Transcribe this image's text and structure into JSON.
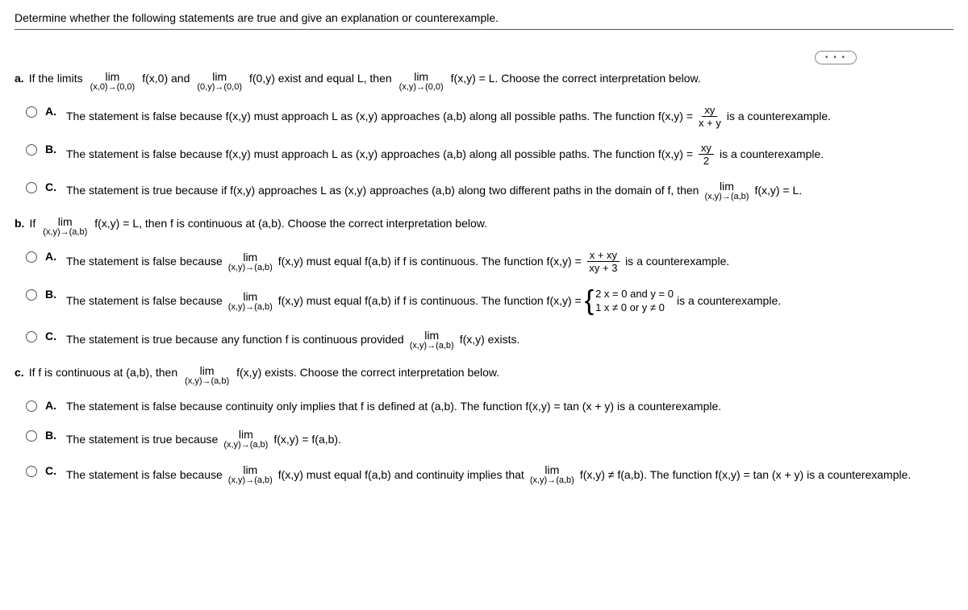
{
  "title": "Determine whether the following statements are true and give an explanation or counterexample.",
  "dots": "• • •",
  "partA": {
    "label": "a.",
    "s1": "If the limits",
    "lim1_top": "lim",
    "lim1_bot": "(x,0)→(0,0)",
    "lim1_after": "f(x,0) and",
    "lim2_top": "lim",
    "lim2_bot": "(0,y)→(0,0)",
    "lim2_after": "f(0,y) exist and equal L, then",
    "lim3_top": "lim",
    "lim3_bot": "(x,y)→(0,0)",
    "lim3_after": "f(x,y) = L. Choose the correct interpretation below.",
    "A": {
      "label": "A.",
      "s1": "The statement is false because f(x,y) must approach L as (x,y) approaches (a,b) along all possible paths. The function f(x,y) =",
      "frac_num": "xy",
      "frac_den": "x + y",
      "s2": "is a counterexample."
    },
    "B": {
      "label": "B.",
      "s1": "The statement is false because f(x,y) must approach L as (x,y) approaches (a,b) along all possible paths. The function f(x,y) =",
      "frac_num": "xy",
      "frac_den": "2",
      "s2": "is a counterexample."
    },
    "C": {
      "label": "C.",
      "s1": "The statement is true because if f(x,y) approaches L as (x,y) approaches (a,b) along two different paths in the domain of f, then",
      "lim_top": "lim",
      "lim_bot": "(x,y)→(a,b)",
      "lim_after": "f(x,y) = L."
    }
  },
  "partB": {
    "label": "b.",
    "s1": "If",
    "lim_top": "lim",
    "lim_bot": "(x,y)→(a,b)",
    "lim_after": "f(x,y) = L, then f is continuous at (a,b). Choose the correct interpretation below.",
    "A": {
      "label": "A.",
      "s1": "The statement is false because",
      "lim_top": "lim",
      "lim_bot": "(x,y)→(a,b)",
      "s2": "f(x,y) must equal f(a,b) if f is continuous. The function f(x,y) =",
      "frac_num": "x + xy",
      "frac_den": "xy + 3",
      "s3": "is a counterexample."
    },
    "B": {
      "label": "B.",
      "s1": "The statement is false because",
      "lim_top": "lim",
      "lim_bot": "(x,y)→(a,b)",
      "s2": "f(x,y) must equal f(a,b) if f is continuous. The function f(x,y) =",
      "case1": "2   x = 0 and y = 0",
      "case2": "1   x ≠ 0 or y ≠ 0",
      "s3": "is a counterexample."
    },
    "C": {
      "label": "C.",
      "s1": "The statement is true because any function f is continuous provided",
      "lim_top": "lim",
      "lim_bot": "(x,y)→(a,b)",
      "lim_after": "f(x,y) exists."
    }
  },
  "partC": {
    "label": "c.",
    "s1": "If f is continuous at (a,b), then",
    "lim_top": "lim",
    "lim_bot": "(x,y)→(a,b)",
    "lim_after": "f(x,y) exists. Choose the correct interpretation below.",
    "A": {
      "label": "A.",
      "s1": "The statement is false because continuity only implies that f is defined at (a,b). The function f(x,y) = tan (x + y) is a counterexample."
    },
    "B": {
      "label": "B.",
      "s1": "The statement is true because",
      "lim_top": "lim",
      "lim_bot": "(x,y)→(a,b)",
      "lim_after": "f(x,y) = f(a,b)."
    },
    "C": {
      "label": "C.",
      "s1": "The statement is false because",
      "lim_top": "lim",
      "lim_bot": "(x,y)→(a,b)",
      "s2": "f(x,y) must equal f(a,b) and continuity implies that",
      "lim2_top": "lim",
      "lim2_bot": "(x,y)→(a,b)",
      "s3": "f(x,y) ≠ f(a,b). The function f(x,y) = tan (x + y) is a counterexample."
    }
  }
}
